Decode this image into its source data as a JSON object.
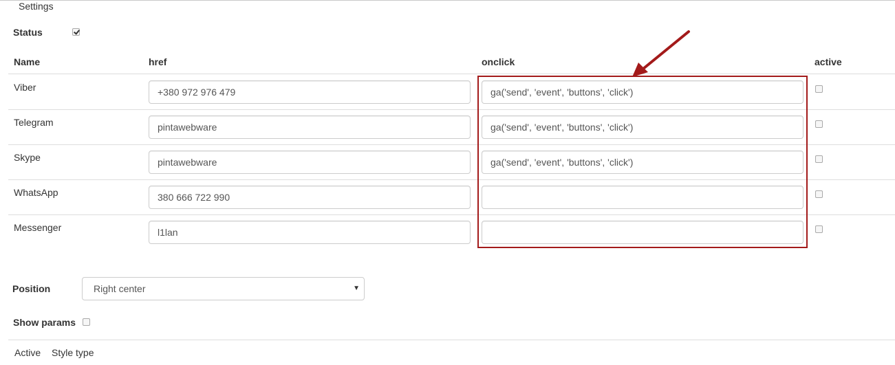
{
  "fieldset": {
    "legend": "Settings"
  },
  "status": {
    "label": "Status",
    "checked": true
  },
  "table": {
    "headers": {
      "name": "Name",
      "href": "href",
      "onclick": "onclick",
      "active": "active"
    },
    "rows": [
      {
        "name": "Viber",
        "href": "+380 972 976 479",
        "onclick": "ga('send', 'event', 'buttons', 'click')",
        "active": false
      },
      {
        "name": "Telegram",
        "href": "pintawebware",
        "onclick": "ga('send', 'event', 'buttons', 'click')",
        "active": false
      },
      {
        "name": "Skype",
        "href": "pintawebware",
        "onclick": "ga('send', 'event', 'buttons', 'click')",
        "active": false
      },
      {
        "name": "WhatsApp",
        "href": "380 666 722 990",
        "onclick": "",
        "active": false
      },
      {
        "name": "Messenger",
        "href": "l1lan",
        "onclick": "",
        "active": false
      }
    ]
  },
  "annotation": {
    "color": "#a31a1a"
  },
  "position": {
    "label": "Position",
    "selected": "Right center"
  },
  "show_params": {
    "label": "Show params",
    "checked": false
  },
  "tabs": {
    "active": "Active",
    "style_type": "Style type"
  }
}
